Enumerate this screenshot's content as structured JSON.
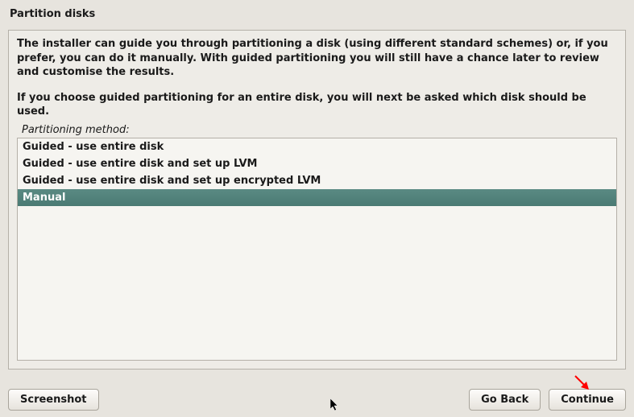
{
  "title": "Partition disks",
  "description": "The installer can guide you through partitioning a disk (using different standard schemes) or, if you prefer, you can do it manually. With guided partitioning you will still have a chance later to review and customise the results.",
  "description2": "If you choose guided partitioning for an entire disk, you will next be asked which disk should be used.",
  "method_label": "Partitioning method:",
  "options": [
    "Guided - use entire disk",
    "Guided - use entire disk and set up LVM",
    "Guided - use entire disk and set up encrypted LVM",
    "Manual"
  ],
  "selected_index": 3,
  "buttons": {
    "screenshot": "Screenshot",
    "goback": "Go Back",
    "continue": "Continue"
  }
}
